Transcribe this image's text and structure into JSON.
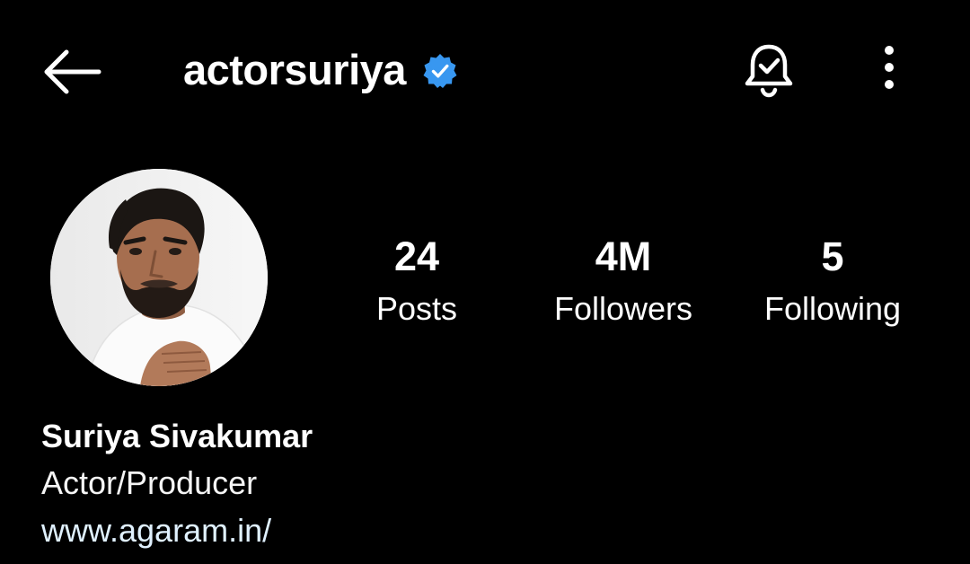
{
  "header": {
    "back_icon": "arrow-left-icon",
    "username": "actorsuriya",
    "verified_icon": "verified-badge-icon",
    "notification_icon": "bell-check-icon",
    "more_icon": "more-vertical-icon"
  },
  "profile": {
    "avatar_icon": "profile-photo",
    "stats": [
      {
        "value": "24",
        "label": "Posts"
      },
      {
        "value": "4M",
        "label": "Followers"
      },
      {
        "value": "5",
        "label": "Following"
      }
    ],
    "name": "Suriya Sivakumar",
    "category": "Actor/Producer",
    "website": "www.agaram.in/"
  },
  "colors": {
    "background": "#000000",
    "text": "#ffffff",
    "verified_badge": "#3897f0",
    "link": "#e0f1ff"
  }
}
